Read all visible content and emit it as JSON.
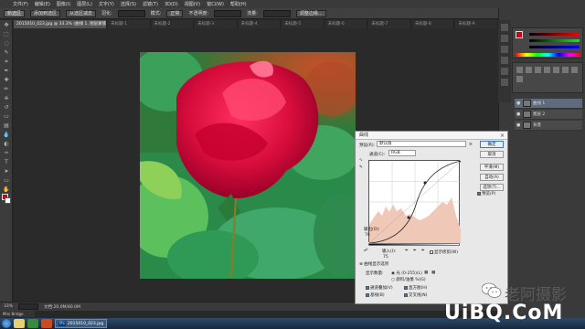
{
  "menubar": {
    "logo": "Ps",
    "items": [
      "文件(F)",
      "编辑(E)",
      "图像(I)",
      "图层(L)",
      "文字(Y)",
      "选择(S)",
      "滤镜(T)",
      "3D(D)",
      "视图(V)",
      "窗口(W)",
      "帮助(H)"
    ]
  },
  "optionsbar": {
    "mode_label": "模式:",
    "mode_value": "正常",
    "opacity_label": "不透明度:",
    "flow_label": "流量:",
    "buttons": [
      "新选区",
      "添加到选区",
      "从选区减去",
      "羽化:"
    ],
    "right_label": "调整边缘..."
  },
  "document_tabs": [
    {
      "label": "2015010_023.jpg @ 33.3% (曲线 1, 图层蒙版/8) ×",
      "active": true
    },
    {
      "label": "未标题-1",
      "active": false
    },
    {
      "label": "未标题-2",
      "active": false
    },
    {
      "label": "未标题-3",
      "active": false
    },
    {
      "label": "未标题-4",
      "active": false
    },
    {
      "label": "未标题-5",
      "active": false
    },
    {
      "label": "未标题-6",
      "active": false
    },
    {
      "label": "未标题-7",
      "active": false
    },
    {
      "label": "未标题-8",
      "active": false
    },
    {
      "label": "未标题-9",
      "active": false
    }
  ],
  "statusbar": {
    "zoom": "33%",
    "doc_info": "文档:20.0M/80.0M",
    "bridge_label": "Mini Bridge"
  },
  "layers": [
    {
      "name": "曲线 1",
      "selected": true
    },
    {
      "name": "图层 2",
      "selected": false
    },
    {
      "name": "背景",
      "selected": false
    }
  ],
  "curves_dialog": {
    "title": "曲线",
    "close": "×",
    "preset_label": "预设(R):",
    "preset_value": "默认值",
    "channel_label": "通道(C):",
    "channel_value": "RGB",
    "output_label": "输出(O):",
    "output_value": "76",
    "input_label": "输入(I):",
    "input_value": "75",
    "show_clipping": "显示修剪(W)",
    "curve_display_options": "曲线显示选项",
    "show_amount_label": "显示数量:",
    "light_option": "光 (0-255)(L)",
    "pigment_option": "颜料/油墨 %(G)",
    "channel_overlays": "通道叠加(V)",
    "histogram": "直方图(H)",
    "baseline": "基线(B)",
    "intersection": "交叉线(N)",
    "buttons": {
      "ok": "确定",
      "cancel": "取消",
      "smooth": "平滑(M)",
      "auto": "自动(A)",
      "options": "选项(T)...",
      "preview": "预览(P)"
    }
  },
  "watermark": {
    "brand": "老阿摄影",
    "url": "UiBQ.CoM"
  },
  "taskbar": {
    "active_window": "2015010_023.jpg"
  }
}
